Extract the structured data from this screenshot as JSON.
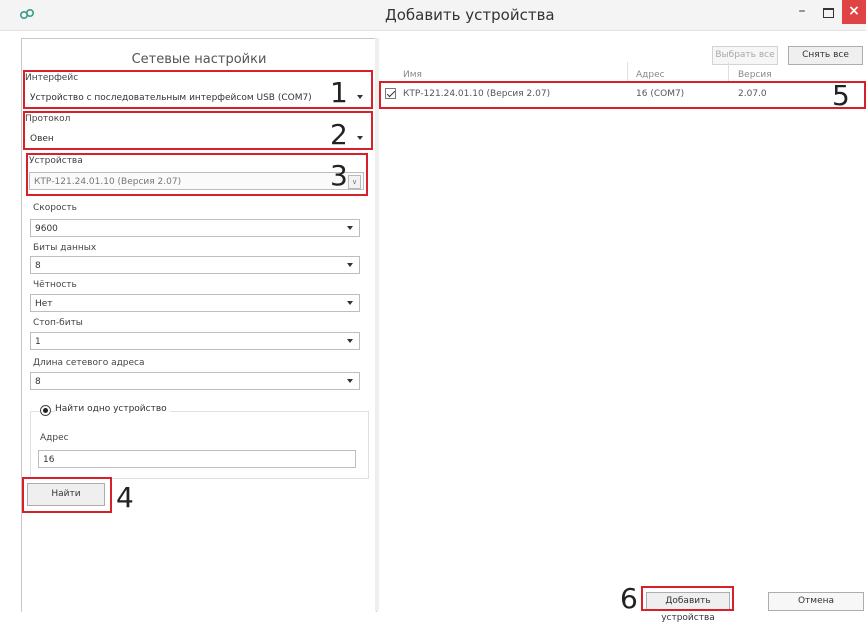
{
  "window": {
    "title": "Добавить устройства",
    "minimize": "–",
    "close": "×"
  },
  "left": {
    "panel_title": "Сетевые настройки",
    "interface": {
      "label": "Интерфейс",
      "value": "Устройство с последовательным интерфейсом USB (COM7)"
    },
    "protocol": {
      "label": "Протокол",
      "value": "Овен"
    },
    "devices": {
      "label": "Устройства",
      "value": "КТР-121.24.01.10 (Версия 2.07)",
      "dropdown_glyph": "∨"
    },
    "speed": {
      "label": "Скорость",
      "value": "9600"
    },
    "data_bits": {
      "label": "Биты данных",
      "value": "8"
    },
    "parity": {
      "label": "Чётность",
      "value": "Нет"
    },
    "stop_bits": {
      "label": "Стоп-биты",
      "value": "1"
    },
    "address_length": {
      "label": "Длина сетевого адреса",
      "value": "8"
    },
    "find_one": {
      "label": "Найти одно устройство",
      "selected": true
    },
    "address": {
      "label": "Адрес",
      "value": "16"
    },
    "find_button": "Найти"
  },
  "right": {
    "select_all": "Выбрать все",
    "deselect_all": "Снять все",
    "columns": [
      "Имя",
      "Адрес",
      "Версия"
    ],
    "rows": [
      {
        "checked": true,
        "name": "КТР-121.24.01.10 (Версия 2.07)",
        "address": "16 (COM7)",
        "version": "2.07.0"
      }
    ],
    "add_button": "Добавить устройства",
    "cancel_button": "Отмена"
  },
  "annotations": [
    "1",
    "2",
    "3",
    "4",
    "5",
    "6"
  ],
  "colors": {
    "highlight": "#d6202b",
    "close_button": "#e04343"
  }
}
